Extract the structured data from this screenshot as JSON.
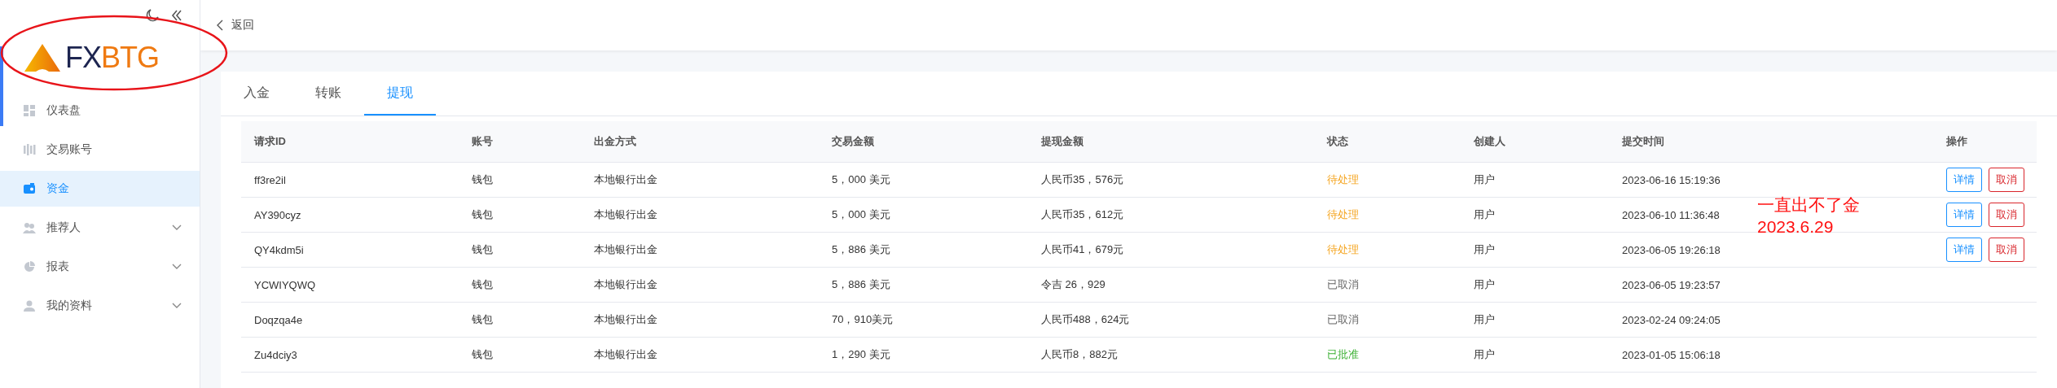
{
  "logo": {
    "prefix": "FX",
    "suffix": "BTG"
  },
  "sidebar": {
    "items": [
      {
        "label": "仪表盘",
        "selected": false
      },
      {
        "label": "交易账号",
        "selected": false
      },
      {
        "label": "资金",
        "selected": true
      },
      {
        "label": "推荐人",
        "selected": false,
        "expanded": false
      },
      {
        "label": "报表",
        "selected": false,
        "expanded": false
      },
      {
        "label": "我的资料",
        "selected": false,
        "expanded": false
      }
    ]
  },
  "topbar": {
    "back_label": "返回"
  },
  "tabs": [
    {
      "label": "入金",
      "selected": false
    },
    {
      "label": "转账",
      "selected": false
    },
    {
      "label": "提现",
      "selected": true
    }
  ],
  "table": {
    "columns": [
      "请求ID",
      "账号",
      "出金方式",
      "交易金额",
      "提现金额",
      "状态",
      "创建人",
      "提交时间",
      "操作"
    ],
    "rows": [
      {
        "id": "ff3re2il",
        "account": "钱包",
        "method": "本地银行出金",
        "amount": "5，000 美元",
        "withdrawal": "人民币35，576元",
        "status": {
          "text": "待处理",
          "kind": "pending"
        },
        "creator": "用户",
        "time": "2023-06-16 15:19:36",
        "actions": [
          {
            "label": "详情",
            "kind": "details"
          },
          {
            "label": "取消",
            "kind": "cancel"
          }
        ]
      },
      {
        "id": "AY390cyz",
        "account": "钱包",
        "method": "本地银行出金",
        "amount": "5，000 美元",
        "withdrawal": "人民币35，612元",
        "status": {
          "text": "待处理",
          "kind": "pending"
        },
        "creator": "用户",
        "time": "2023-06-10 11:36:48",
        "actions": [
          {
            "label": "详情",
            "kind": "details"
          },
          {
            "label": "取消",
            "kind": "cancel"
          }
        ]
      },
      {
        "id": "QY4kdm5i",
        "account": "钱包",
        "method": "本地银行出金",
        "amount": "5，886 美元",
        "withdrawal": "人民币41，679元",
        "status": {
          "text": "待处理",
          "kind": "pending"
        },
        "creator": "用户",
        "time": "2023-06-05 19:26:18",
        "actions": [
          {
            "label": "详情",
            "kind": "details"
          },
          {
            "label": "取消",
            "kind": "cancel"
          }
        ]
      },
      {
        "id": "YCWIYQWQ",
        "account": "钱包",
        "method": "本地银行出金",
        "amount": "5，886 美元",
        "withdrawal": "令吉 26，929",
        "status": {
          "text": "已取消",
          "kind": "cancelled"
        },
        "creator": "用户",
        "time": "2023-06-05 19:23:57"
      },
      {
        "id": "Doqzqa4e",
        "account": "钱包",
        "method": "本地银行出金",
        "amount": "70，910美元",
        "withdrawal": "人民币488，624元",
        "status": {
          "text": "已取消",
          "kind": "cancelled"
        },
        "creator": "用户",
        "time": "2023-02-24 09:24:05"
      },
      {
        "id": "Zu4dciy3",
        "account": "钱包",
        "method": "本地银行出金",
        "amount": "1，290 美元",
        "withdrawal": "人民币8，882元",
        "status": {
          "text": "已批准",
          "kind": "approved"
        },
        "creator": "用户",
        "time": "2023-01-05 15:06:18"
      }
    ]
  },
  "annotation": {
    "lines": [
      "一直出不了金",
      "2023.6.29"
    ]
  }
}
